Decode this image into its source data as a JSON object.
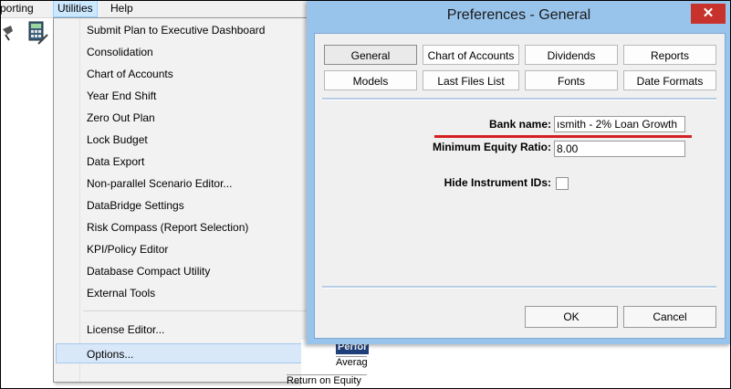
{
  "menubar": {
    "items": [
      "porting",
      "Utilities",
      "Help"
    ]
  },
  "utilities_menu": {
    "items": [
      "Submit Plan to Executive Dashboard",
      "Consolidation",
      "Chart of Accounts",
      "Year End Shift",
      "Zero Out Plan",
      "Lock Budget",
      "Data Export",
      "Non-parallel Scenario Editor...",
      "DataBridge Settings",
      "Risk Compass (Report Selection)",
      "KPI/Policy Editor",
      "Database Compact Utility",
      "External Tools"
    ],
    "items_after_separator": [
      "License Editor...",
      "Options..."
    ],
    "highlighted": "Options..."
  },
  "background": {
    "perf_label": "Perfor",
    "aver_label": "Averag",
    "roe_label": "Return on Equity"
  },
  "dialog": {
    "title": "Preferences - General",
    "close_glyph": "✕",
    "tabs": [
      "General",
      "Chart of Accounts",
      "Dividends",
      "Reports",
      "Models",
      "Last Files List",
      "Fonts",
      "Date Formats"
    ],
    "selected_tab": "General",
    "fields": {
      "bank_name_label": "Bank name:",
      "bank_name_value": "ısmith - 2% Loan Growth",
      "min_equity_label": "Minimum Equity Ratio:",
      "min_equity_value": "8.00",
      "hide_ids_label": "Hide Instrument IDs:",
      "hide_ids_checked": false
    },
    "buttons": {
      "ok": "OK",
      "cancel": "Cancel"
    }
  },
  "colors": {
    "dialog_frame": "#98c4ec",
    "close_button": "#c8322c",
    "highlight": "#d9e8f8",
    "annotation_underline": "#d42020"
  }
}
